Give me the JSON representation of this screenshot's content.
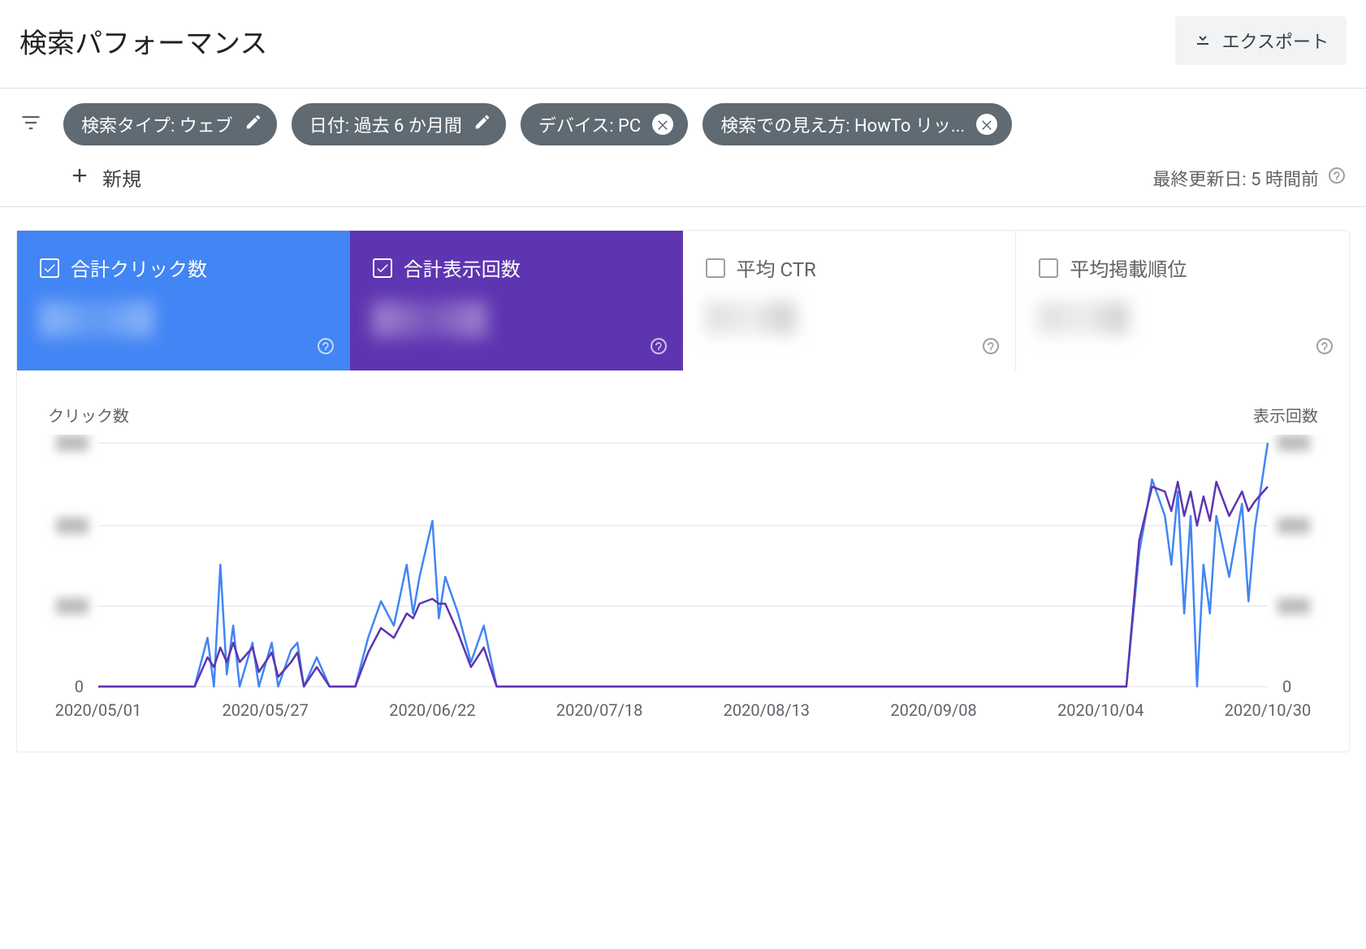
{
  "header": {
    "title": "検索パフォーマンス",
    "export_label": "エクスポート"
  },
  "filters": {
    "chips": [
      {
        "label": "検索タイプ: ウェブ",
        "action": "edit"
      },
      {
        "label": "日付: 過去 6 か月間",
        "action": "edit"
      },
      {
        "label": "デバイス: PC",
        "action": "close"
      },
      {
        "label": "検索での見え方: HowTo リッ...",
        "action": "close"
      }
    ],
    "new_label": "新規",
    "last_update": "最終更新日: 5 時間前"
  },
  "metrics": [
    {
      "label": "合計クリック数",
      "checked": true,
      "color": "blue"
    },
    {
      "label": "合計表示回数",
      "checked": true,
      "color": "purple"
    },
    {
      "label": "平均 CTR",
      "checked": false,
      "color": "none"
    },
    {
      "label": "平均掲載順位",
      "checked": false,
      "color": "none"
    }
  ],
  "chart_labels": {
    "left_axis": "クリック数",
    "right_axis": "表示回数",
    "zero": "0"
  },
  "chart_data": {
    "type": "line",
    "x_ticks": [
      "2020/05/01",
      "2020/05/27",
      "2020/06/22",
      "2020/07/18",
      "2020/08/13",
      "2020/09/08",
      "2020/10/04",
      "2020/10/30"
    ],
    "x_range": [
      "2020-05-01",
      "2020-10-30"
    ],
    "y_left_range": [
      0,
      100
    ],
    "y_right_range": [
      0,
      100
    ],
    "y_note": "y-axis tick values are blurred in the source image; values below are relative percentages of the visible max",
    "series": [
      {
        "name": "クリック数",
        "axis": "left",
        "color": "#4285f4",
        "points": [
          [
            "2020-05-01",
            0
          ],
          [
            "2020-05-16",
            0
          ],
          [
            "2020-05-18",
            20
          ],
          [
            "2020-05-19",
            0
          ],
          [
            "2020-05-20",
            50
          ],
          [
            "2020-05-21",
            5
          ],
          [
            "2020-05-22",
            25
          ],
          [
            "2020-05-23",
            0
          ],
          [
            "2020-05-25",
            18
          ],
          [
            "2020-05-26",
            0
          ],
          [
            "2020-05-28",
            18
          ],
          [
            "2020-05-29",
            0
          ],
          [
            "2020-05-31",
            15
          ],
          [
            "2020-06-01",
            18
          ],
          [
            "2020-06-02",
            0
          ],
          [
            "2020-06-04",
            12
          ],
          [
            "2020-06-06",
            0
          ],
          [
            "2020-06-10",
            0
          ],
          [
            "2020-06-12",
            20
          ],
          [
            "2020-06-14",
            35
          ],
          [
            "2020-06-16",
            25
          ],
          [
            "2020-06-18",
            50
          ],
          [
            "2020-06-19",
            30
          ],
          [
            "2020-06-20",
            45
          ],
          [
            "2020-06-22",
            68
          ],
          [
            "2020-06-23",
            28
          ],
          [
            "2020-06-24",
            45
          ],
          [
            "2020-06-26",
            30
          ],
          [
            "2020-06-28",
            10
          ],
          [
            "2020-06-30",
            25
          ],
          [
            "2020-07-02",
            0
          ],
          [
            "2020-10-08",
            0
          ],
          [
            "2020-10-10",
            55
          ],
          [
            "2020-10-12",
            85
          ],
          [
            "2020-10-14",
            70
          ],
          [
            "2020-10-15",
            50
          ],
          [
            "2020-10-16",
            80
          ],
          [
            "2020-10-17",
            30
          ],
          [
            "2020-10-18",
            70
          ],
          [
            "2020-10-19",
            0
          ],
          [
            "2020-10-20",
            50
          ],
          [
            "2020-10-21",
            30
          ],
          [
            "2020-10-22",
            70
          ],
          [
            "2020-10-24",
            45
          ],
          [
            "2020-10-26",
            75
          ],
          [
            "2020-10-27",
            35
          ],
          [
            "2020-10-28",
            65
          ],
          [
            "2020-10-30",
            100
          ]
        ]
      },
      {
        "name": "表示回数",
        "axis": "right",
        "color": "#5e35b1",
        "points": [
          [
            "2020-05-01",
            0
          ],
          [
            "2020-05-16",
            0
          ],
          [
            "2020-05-18",
            12
          ],
          [
            "2020-05-19",
            8
          ],
          [
            "2020-05-20",
            16
          ],
          [
            "2020-05-21",
            10
          ],
          [
            "2020-05-22",
            18
          ],
          [
            "2020-05-23",
            10
          ],
          [
            "2020-05-25",
            16
          ],
          [
            "2020-05-26",
            6
          ],
          [
            "2020-05-28",
            14
          ],
          [
            "2020-05-29",
            4
          ],
          [
            "2020-05-31",
            10
          ],
          [
            "2020-06-01",
            14
          ],
          [
            "2020-06-02",
            0
          ],
          [
            "2020-06-04",
            8
          ],
          [
            "2020-06-06",
            0
          ],
          [
            "2020-06-10",
            0
          ],
          [
            "2020-06-12",
            14
          ],
          [
            "2020-06-14",
            24
          ],
          [
            "2020-06-16",
            20
          ],
          [
            "2020-06-18",
            30
          ],
          [
            "2020-06-19",
            28
          ],
          [
            "2020-06-20",
            34
          ],
          [
            "2020-06-22",
            36
          ],
          [
            "2020-06-23",
            34
          ],
          [
            "2020-06-24",
            34
          ],
          [
            "2020-06-26",
            22
          ],
          [
            "2020-06-28",
            8
          ],
          [
            "2020-06-30",
            16
          ],
          [
            "2020-07-02",
            0
          ],
          [
            "2020-10-08",
            0
          ],
          [
            "2020-10-10",
            60
          ],
          [
            "2020-10-12",
            82
          ],
          [
            "2020-10-14",
            80
          ],
          [
            "2020-10-15",
            72
          ],
          [
            "2020-10-16",
            84
          ],
          [
            "2020-10-17",
            70
          ],
          [
            "2020-10-18",
            80
          ],
          [
            "2020-10-19",
            66
          ],
          [
            "2020-10-20",
            78
          ],
          [
            "2020-10-21",
            68
          ],
          [
            "2020-10-22",
            84
          ],
          [
            "2020-10-24",
            70
          ],
          [
            "2020-10-26",
            80
          ],
          [
            "2020-10-27",
            72
          ],
          [
            "2020-10-28",
            76
          ],
          [
            "2020-10-30",
            82
          ]
        ]
      }
    ]
  }
}
